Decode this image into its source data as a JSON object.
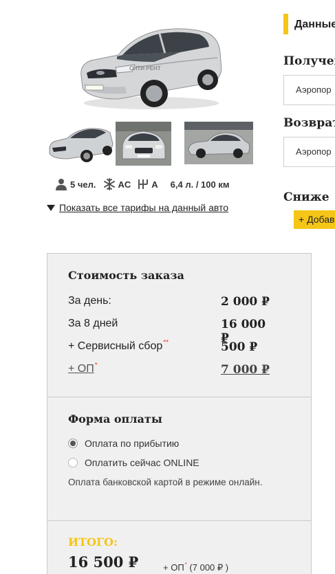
{
  "car": {
    "main_photo_icon": "car-photo",
    "watermark_text": "СИТИ РЕНТ",
    "thumbnails": [
      "car-thumb-front-side",
      "car-thumb-front",
      "car-thumb-side"
    ]
  },
  "specs": {
    "seats": "5 чел.",
    "climate": "AC",
    "gearbox": "A",
    "fuel": "6,4 л. / 100 км"
  },
  "tariffs_link": "Показать все тарифы на данный авто",
  "right_panel": {
    "data_title": "Данные",
    "pickup_label": "Получен",
    "pickup_value": "Аэропор",
    "return_label": "Возврат",
    "return_value": "Аэропор",
    "discount_label": "Сниже",
    "add_button": "+ Добав"
  },
  "order": {
    "title": "Стоимость заказа",
    "rows": [
      {
        "label": "За день:",
        "value": "2 000 ₽"
      },
      {
        "label": "За 8 дней",
        "value": "16 000 ₽"
      },
      {
        "label": "+ Сервисный сбор",
        "marker": "**",
        "value": "500 ₽"
      },
      {
        "label": "+ ОП",
        "marker": "*",
        "value": "7 000 ₽"
      }
    ]
  },
  "payment": {
    "title": "Форма оплаты",
    "options": [
      {
        "label": "Оплата по прибытию",
        "selected": true
      },
      {
        "label": "Оплатить сейчас ONLINE",
        "selected": false
      }
    ],
    "note": "Оплата банковской картой в режиме онлайн."
  },
  "total": {
    "label": "ИТОГО:",
    "value": "16 500 ₽",
    "op_prefix": "+ ОП",
    "op_marker": "*",
    "op_amount": "(7 000 ₽ )"
  },
  "colors": {
    "accent": "#f5c518",
    "required_marker": "#e8412c",
    "box_bg": "#f0f0f0"
  }
}
